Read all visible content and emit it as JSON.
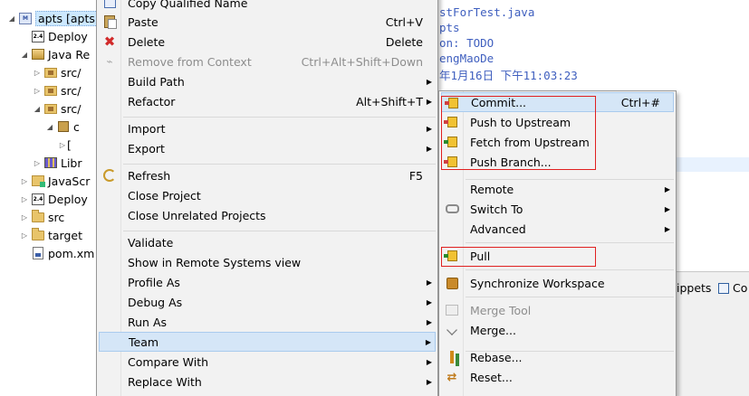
{
  "explorer": {
    "items": [
      {
        "label": "apts  [apts",
        "arrow": "◢",
        "icon": "project-icon",
        "indent": 0,
        "selected": true
      },
      {
        "label": "Deploy",
        "arrow": "",
        "icon": "deploy-icon",
        "indent": 1
      },
      {
        "label": "Java Re",
        "arrow": "◢",
        "icon": "java-resources-icon",
        "indent": 1
      },
      {
        "label": "src/",
        "arrow": "▷",
        "icon": "source-folder-icon",
        "indent": 2
      },
      {
        "label": "src/",
        "arrow": "▷",
        "icon": "source-folder-icon",
        "indent": 2
      },
      {
        "label": "src/",
        "arrow": "◢",
        "icon": "source-folder-icon",
        "indent": 2
      },
      {
        "label": "c",
        "arrow": "◢",
        "icon": "package-icon",
        "indent": 3
      },
      {
        "label": "[",
        "arrow": "▷",
        "icon": "",
        "indent": 4
      },
      {
        "label": "Libr",
        "arrow": "▷",
        "icon": "library-icon",
        "indent": 2
      },
      {
        "label": "JavaScr",
        "arrow": "▷",
        "icon": "javascript-resources-icon",
        "indent": 1
      },
      {
        "label": "Deploy",
        "arrow": "▷",
        "icon": "deploy-icon",
        "indent": 1
      },
      {
        "label": "src",
        "arrow": "▷",
        "icon": "folder-icon",
        "indent": 1
      },
      {
        "label": "target",
        "arrow": "▷",
        "icon": "folder-icon",
        "indent": 1
      },
      {
        "label": "pom.xm",
        "arrow": "",
        "icon": "xml-file-icon",
        "indent": 1
      }
    ]
  },
  "editor": {
    "lines": [
      "stForTest.java",
      "pts",
      "on: TODO",
      "engMaoDe",
      "年1月16日 下午11:03:23"
    ]
  },
  "bottom_tabs": {
    "snippets": "ippets",
    "console": "Co"
  },
  "context_menu": {
    "items": [
      {
        "label": "Copy Qualified Name",
        "shortcut": "",
        "submenu": false,
        "icon": "copy-qualified-name-icon",
        "disabled": false
      },
      {
        "label": "Paste",
        "shortcut": "Ctrl+V",
        "submenu": false,
        "icon": "paste-icon",
        "disabled": false
      },
      {
        "label": "Delete",
        "shortcut": "Delete",
        "submenu": false,
        "icon": "delete-icon",
        "disabled": false
      },
      {
        "label": "Remove from Context",
        "shortcut": "Ctrl+Alt+Shift+Down",
        "submenu": false,
        "icon": "remove-context-icon",
        "disabled": true
      },
      {
        "label": "Build Path",
        "shortcut": "",
        "submenu": true,
        "icon": "",
        "disabled": false
      },
      {
        "label": "Refactor",
        "shortcut": "Alt+Shift+T",
        "submenu": true,
        "icon": "",
        "disabled": false
      },
      {
        "label": "Import",
        "shortcut": "",
        "submenu": true,
        "icon": "",
        "disabled": false
      },
      {
        "label": "Export",
        "shortcut": "",
        "submenu": true,
        "icon": "",
        "disabled": false
      },
      {
        "label": "Refresh",
        "shortcut": "F5",
        "submenu": false,
        "icon": "refresh-icon",
        "disabled": false
      },
      {
        "label": "Close Project",
        "shortcut": "",
        "submenu": false,
        "icon": "",
        "disabled": false
      },
      {
        "label": "Close Unrelated Projects",
        "shortcut": "",
        "submenu": false,
        "icon": "",
        "disabled": false
      },
      {
        "label": "Validate",
        "shortcut": "",
        "submenu": false,
        "icon": "",
        "disabled": false
      },
      {
        "label": "Show in Remote Systems view",
        "shortcut": "",
        "submenu": false,
        "icon": "",
        "disabled": false
      },
      {
        "label": "Profile As",
        "shortcut": "",
        "submenu": true,
        "icon": "",
        "disabled": false
      },
      {
        "label": "Debug As",
        "shortcut": "",
        "submenu": true,
        "icon": "",
        "disabled": false
      },
      {
        "label": "Run As",
        "shortcut": "",
        "submenu": true,
        "icon": "",
        "disabled": false
      },
      {
        "label": "Team",
        "shortcut": "",
        "submenu": true,
        "icon": "",
        "disabled": false,
        "active": true
      },
      {
        "label": "Compare With",
        "shortcut": "",
        "submenu": true,
        "icon": "",
        "disabled": false
      },
      {
        "label": "Replace With",
        "shortcut": "",
        "submenu": true,
        "icon": "",
        "disabled": false
      }
    ]
  },
  "team_menu": {
    "items": [
      {
        "label": "Commit...",
        "shortcut": "Ctrl+#",
        "submenu": false,
        "icon": "commit-icon",
        "disabled": false,
        "active": true
      },
      {
        "label": "Push to Upstream",
        "shortcut": "",
        "submenu": false,
        "icon": "push-upstream-icon",
        "disabled": false
      },
      {
        "label": "Fetch from Upstream",
        "shortcut": "",
        "submenu": false,
        "icon": "fetch-upstream-icon",
        "disabled": false
      },
      {
        "label": "Push Branch...",
        "shortcut": "",
        "submenu": false,
        "icon": "push-branch-icon",
        "disabled": false
      },
      {
        "label": "Remote",
        "shortcut": "",
        "submenu": true,
        "icon": "",
        "disabled": false
      },
      {
        "label": "Switch To",
        "shortcut": "",
        "submenu": true,
        "icon": "switch-branch-icon",
        "disabled": false
      },
      {
        "label": "Advanced",
        "shortcut": "",
        "submenu": true,
        "icon": "",
        "disabled": false
      },
      {
        "label": "Pull",
        "shortcut": "",
        "submenu": false,
        "icon": "pull-icon",
        "disabled": false
      },
      {
        "label": "Synchronize Workspace",
        "shortcut": "",
        "submenu": false,
        "icon": "synchronize-icon",
        "disabled": false
      },
      {
        "label": "Merge Tool",
        "shortcut": "",
        "submenu": false,
        "icon": "merge-tool-icon",
        "disabled": true
      },
      {
        "label": "Merge...",
        "shortcut": "",
        "submenu": false,
        "icon": "merge-icon",
        "disabled": false
      },
      {
        "label": "Rebase...",
        "shortcut": "",
        "submenu": false,
        "icon": "rebase-icon",
        "disabled": false
      },
      {
        "label": "Reset...",
        "shortcut": "",
        "submenu": false,
        "icon": "reset-icon",
        "disabled": false
      }
    ]
  },
  "colors": {
    "highlight": "#d5e6f7",
    "annotation": "#e02020",
    "menu_bg": "#f2f2f2"
  }
}
